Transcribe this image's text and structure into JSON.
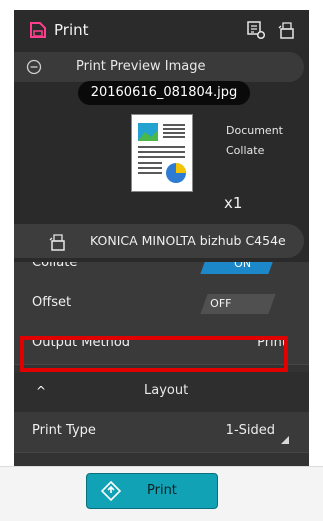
{
  "header": {
    "title": "Print"
  },
  "preview": {
    "label": "Print Preview Image"
  },
  "file": {
    "name": "20160616_081804.jpg"
  },
  "document": {
    "line1": "Document",
    "line2": "Collate",
    "copies": "x1"
  },
  "printer": {
    "name": "KONICA MINOLTA bizhub C454e"
  },
  "settings": {
    "collate": {
      "label": "Collate",
      "state": "ON"
    },
    "offset": {
      "label": "Offset",
      "state": "OFF"
    },
    "output_method": {
      "label": "Output Method",
      "value": "Print"
    },
    "layout": {
      "label": "Layout"
    },
    "print_type": {
      "label": "Print Type",
      "value": "1-Sided"
    }
  },
  "footer": {
    "print_label": "Print"
  },
  "colors": {
    "accent": "#1c87c9",
    "print_button": "#11a3b5",
    "highlight": "#e00000"
  }
}
